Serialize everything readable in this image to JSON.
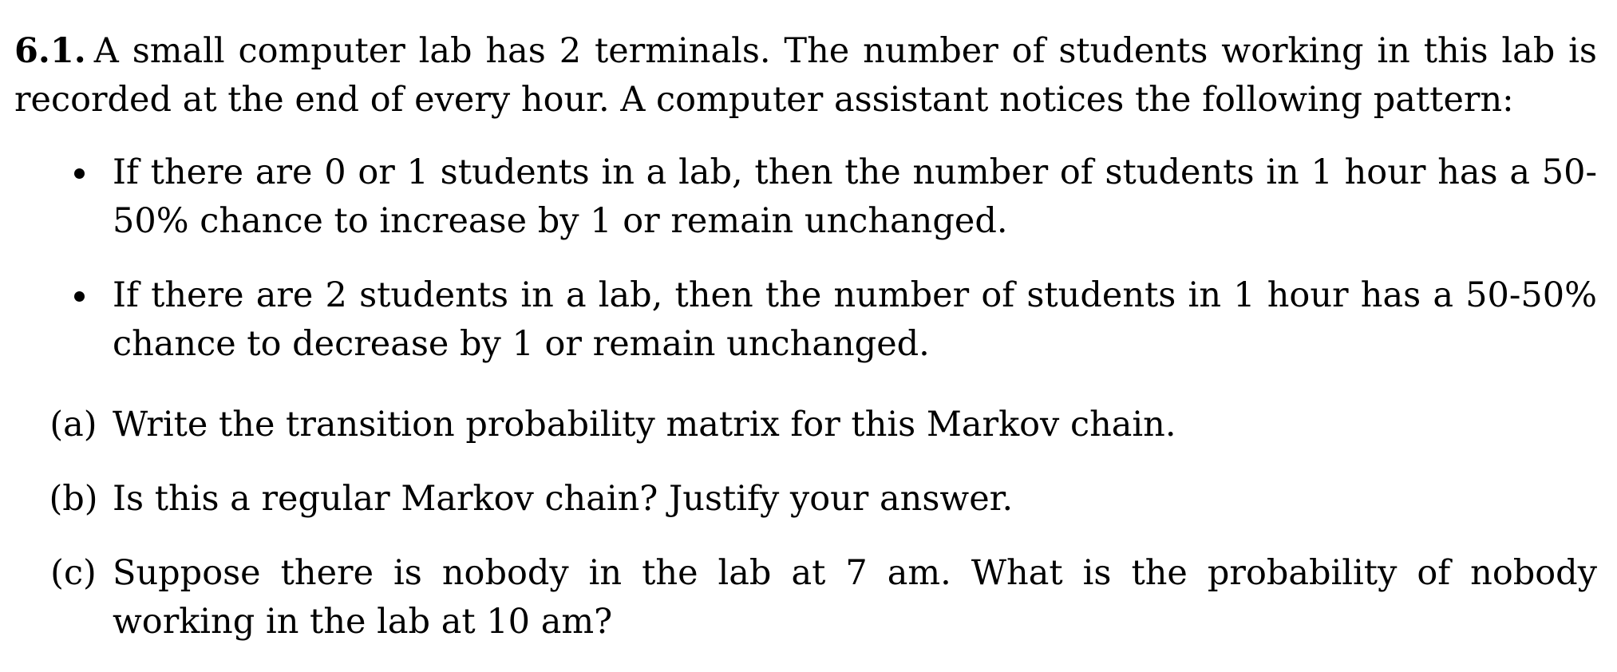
{
  "problem": {
    "number": "6.1.",
    "intro": "A small computer lab has 2 terminals. The number of students working in this lab is recorded at the end of every hour. A computer assistant notices the following pattern:"
  },
  "bullets": [
    "If there are 0 or 1 students in a lab, then the number of students in 1 hour has a 50-50% chance to increase by 1 or remain unchanged.",
    "If there are 2 students in a lab, then the number of students in 1 hour has a 50-50% chance to decrease by 1 or remain unchanged."
  ],
  "parts": [
    {
      "label": "(a)",
      "text": "Write the transition probability matrix for this Markov chain."
    },
    {
      "label": "(b)",
      "text": "Is this a regular Markov chain? Justify your answer."
    },
    {
      "label": "(c)",
      "text": "Suppose there is nobody in the lab at 7 am. What is the probability of nobody working in the lab at 10 am?"
    }
  ]
}
